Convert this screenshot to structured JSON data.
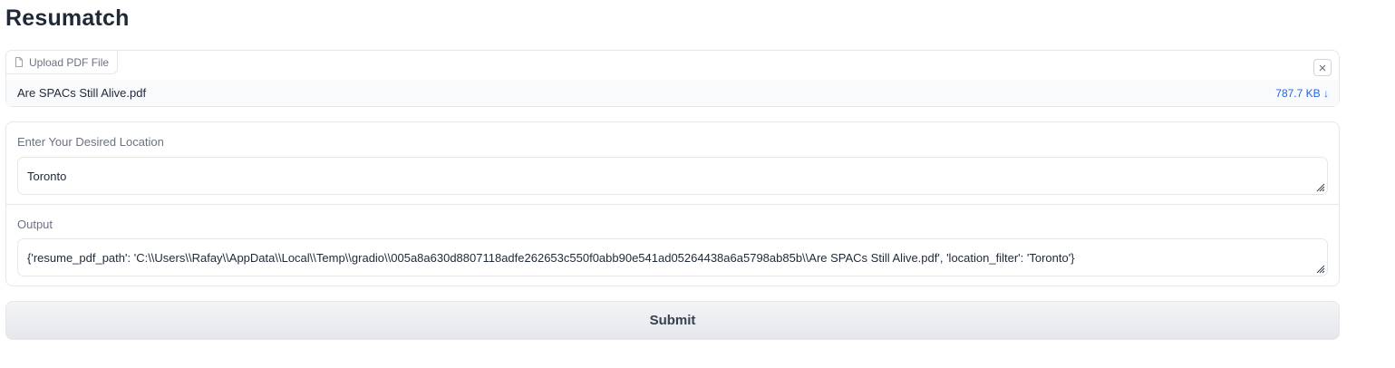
{
  "app": {
    "title": "Resumatch"
  },
  "upload": {
    "label": "Upload PDF File",
    "file_name": "Are SPACs Still Alive.pdf",
    "file_size": "787.7 KB ↓"
  },
  "location": {
    "label": "Enter Your Desired Location",
    "value": "Toronto"
  },
  "output": {
    "label": "Output",
    "value": "{'resume_pdf_path': 'C:\\\\Users\\\\Rafay\\\\AppData\\\\Local\\\\Temp\\\\gradio\\\\005a8a630d8807118adfe262653c550f0abb90e541ad05264438a6a5798ab85b\\\\Are SPACs Still Alive.pdf', 'location_filter': 'Toronto'}"
  },
  "submit": {
    "label": "Submit"
  },
  "colors": {
    "accent": "#2563eb",
    "border": "#e5e7eb",
    "label": "#6b7280"
  },
  "icons": {
    "file": "file-icon",
    "clear": "close-icon",
    "resize": "resize-handle-icon"
  }
}
